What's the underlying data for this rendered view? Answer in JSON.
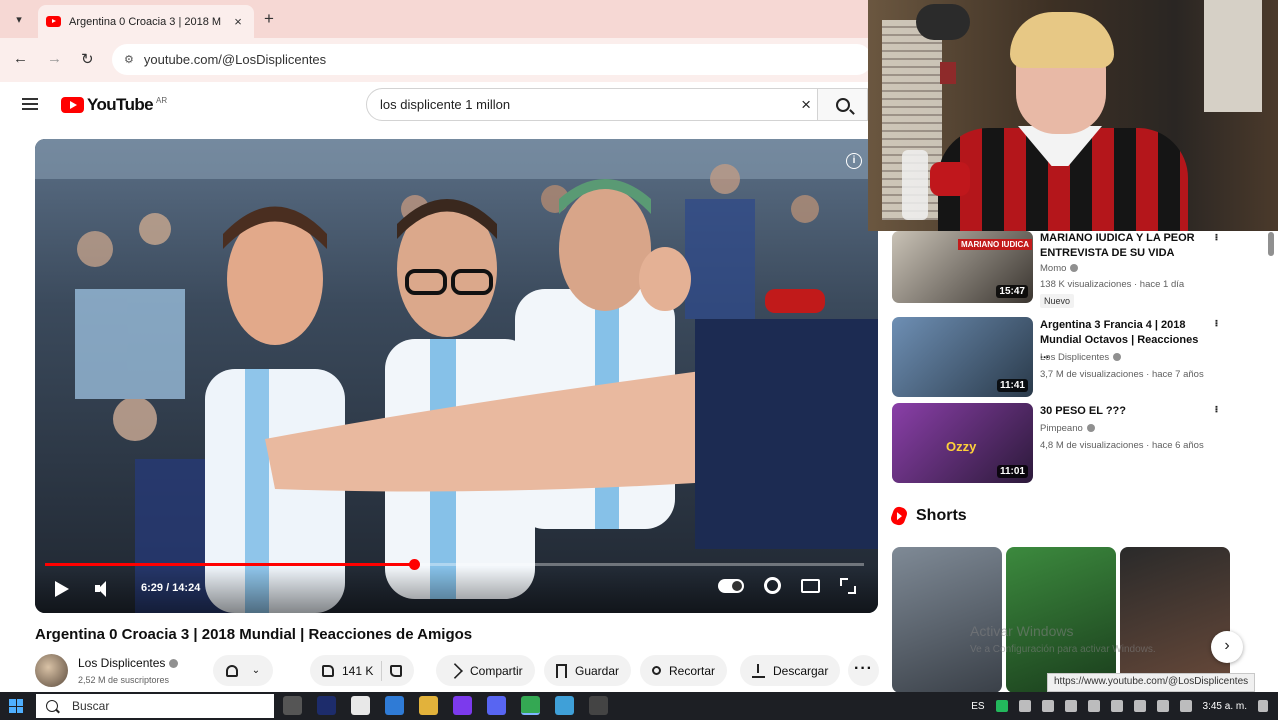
{
  "browser": {
    "tab_title": "Argentina 0 Croacia 3 | 2018 M",
    "url": "youtube.com/@LosDisplicentes",
    "new_tab_icon": "+",
    "close_tab_icon": "×"
  },
  "youtube": {
    "logo_text": "YouTube",
    "country_code": "AR",
    "search_value": "los displicente 1 millon",
    "clear_icon": "×"
  },
  "player": {
    "time": "6:29 / 14:24",
    "progress_fraction": 0.45,
    "info_icon": "i"
  },
  "video": {
    "title": "Argentina 0 Croacia 3 | 2018 Mundial | Reacciones de Amigos",
    "channel": "Los Displicentes",
    "subscribers": "2,52 M de suscriptores",
    "likes": "141 K",
    "share": "Compartir",
    "save": "Guardar",
    "clip": "Recortar",
    "download": "Descargar",
    "more": "···"
  },
  "recommendations": [
    {
      "title": "MARIANO IUDICA Y LA PEOR ENTREVISTA DE SU VIDA",
      "channel": "Momo",
      "meta": "138 K visualizaciones · hace 1 día",
      "badge": "Nuevo",
      "duration": "15:47",
      "thumb_label": "MARIANO IUDICA",
      "colors": [
        "#c9c2b6",
        "#3a3530"
      ]
    },
    {
      "title": "Argentina 3 Francia 4 | 2018 Mundial Octavos | Reacciones ...",
      "channel": "Los Displicentes",
      "meta": "3,7 M de visualizaciones · hace 7 años",
      "duration": "11:41",
      "colors": [
        "#6e8fb4",
        "#2a3a4a"
      ]
    },
    {
      "title": "30 PESO EL ???",
      "channel": "Pimpeano",
      "meta": "4,8 M de visualizaciones · hace 6 años",
      "duration": "11:01",
      "thumb_label": "Ozzy",
      "colors": [
        "#8a3fa8",
        "#2c1a3a"
      ]
    }
  ],
  "shorts": {
    "heading": "Shorts",
    "items": [
      {
        "colors": [
          "#7f8a96",
          "#3a4048"
        ]
      },
      {
        "colors": [
          "#3c8a3e",
          "#1a3d1c"
        ]
      },
      {
        "colors": [
          "#2a2a2a",
          "#6a4a3a"
        ]
      }
    ],
    "next_icon": "›"
  },
  "overlay": {
    "activate_title": "Activar Windows",
    "activate_sub": "Ve a Configuración para activar Windows.",
    "status_url": "https://www.youtube.com/@LosDisplicentes"
  },
  "taskbar": {
    "search_placeholder": "Buscar",
    "language": "ES",
    "clock": "3:45 a. m."
  }
}
